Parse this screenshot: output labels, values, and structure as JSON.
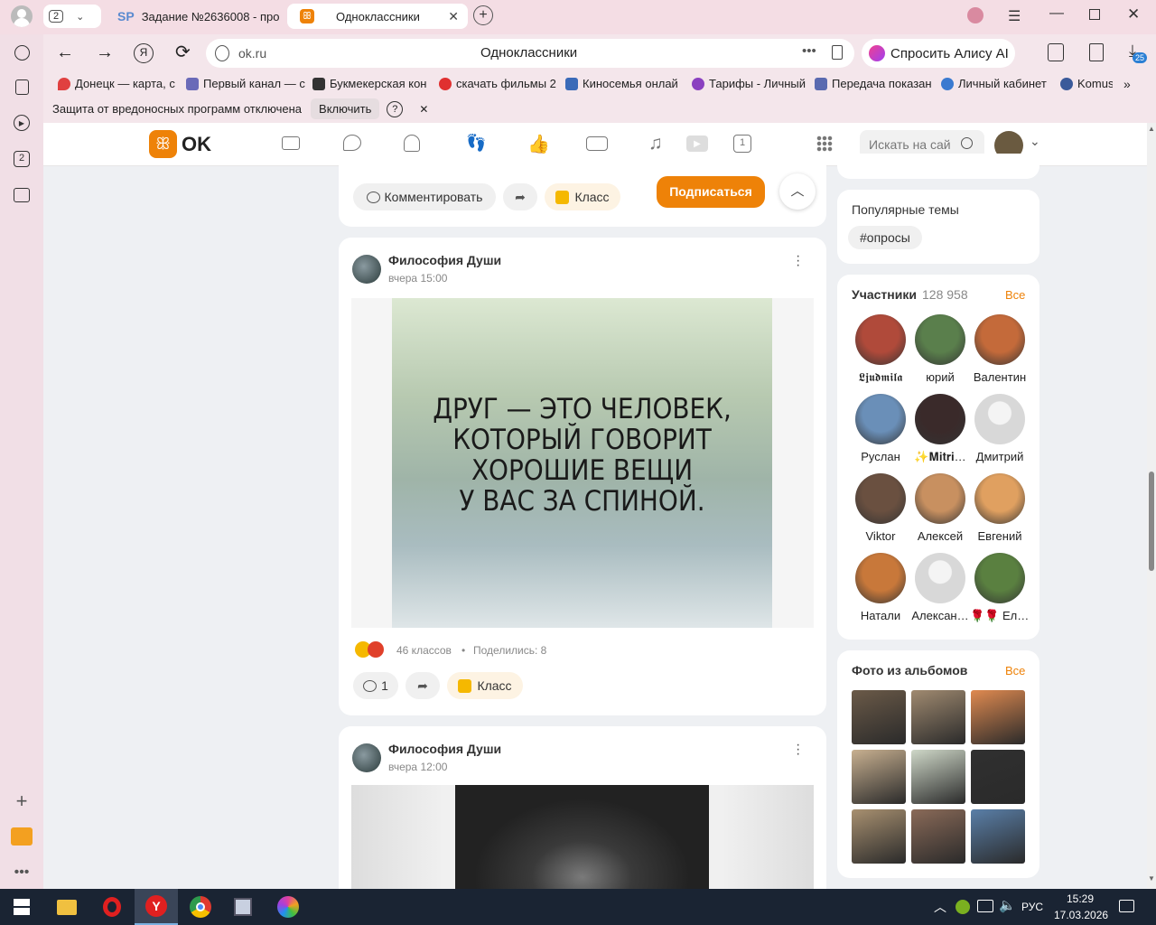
{
  "browser": {
    "tabs": [
      {
        "label": "Задание №2636008 - про",
        "favicon": "SP"
      },
      {
        "label": "Одноклассники",
        "favicon": "ok-icon"
      }
    ],
    "tab_counter": "2",
    "address": "ok.ru",
    "page_title": "Одноклассники",
    "alice_label": "Спросить Алису AI",
    "downloads_badge": "25",
    "bookmarks": [
      "Донецк — карта, с",
      "Первый канал — с",
      "Букмекерская кон",
      "скачать фильмы 2",
      "Киносемья онлай",
      "Тарифы - Личный",
      "Передача показан",
      "Личный кабинет",
      "Komus"
    ],
    "protection": {
      "text": "Защита от вредоносных программ отключена",
      "button": "Включить",
      "help": "?",
      "close": "✕"
    },
    "sidebar_badge": "2"
  },
  "ok": {
    "logo_text": "OK",
    "search_placeholder": "Искать на сай",
    "calendar_day": "1"
  },
  "post_top": {
    "comment_label": "Комментировать",
    "class_label": "Класс",
    "subscribe_label": "Подписаться"
  },
  "post1": {
    "author": "Философия Души",
    "time": "вчера 15:00",
    "quote_lines": [
      "ДРУГ — ЭТО ЧЕЛОВЕК,",
      "КОТОРЫЙ ГОВОРИТ",
      "ХОРОШИЕ ВЕЩИ",
      "У ВАС ЗА СПИНОЙ."
    ],
    "likes": "46 классов",
    "dot": "•",
    "shares": "Поделились: 8",
    "comments_count": "1",
    "class_label": "Класс"
  },
  "post2": {
    "author": "Философия Души",
    "time": "вчера 12:00"
  },
  "popular": {
    "title": "Популярные темы",
    "tag": "#опросы"
  },
  "members": {
    "title": "Участники",
    "count": "128 958",
    "all": "Все",
    "list": [
      {
        "name": "𝕷𝖏𝖚𝖉𝖒𝖎𝖑𝖆",
        "color": "#b04a3a"
      },
      {
        "name": "юрий",
        "color": "#5a7f4c"
      },
      {
        "name": "Валентин",
        "color": "#c46a3a"
      },
      {
        "name": "Руслан",
        "color": "#6a8fb8"
      },
      {
        "name": "✨𝐌𝐢𝐭𝐫𝐢…",
        "color": "#3a2a2a"
      },
      {
        "name": "Дмитрий",
        "color": "#d8d8d8"
      },
      {
        "name": "Viktor",
        "color": "#6a5040"
      },
      {
        "name": "Алексей",
        "color": "#c89060"
      },
      {
        "name": "Евгений",
        "color": "#e0a060"
      },
      {
        "name": "Натали",
        "color": "#c8783a"
      },
      {
        "name": "Алексан…",
        "color": "#d8d8d8"
      },
      {
        "name": "🌹🌹 Елена",
        "color": "#5a8040"
      }
    ]
  },
  "albums": {
    "title": "Фото из альбомов",
    "all": "Все",
    "colors": [
      "#6b5a48",
      "#a08a70",
      "#e08a50",
      "#c8b090",
      "#cfd8c8",
      "#303030",
      "#a89070",
      "#8a6a58",
      "#5a7fa8"
    ]
  },
  "taskbar": {
    "lang": "РУС",
    "time": "15:29",
    "date": "17.03.2026"
  }
}
